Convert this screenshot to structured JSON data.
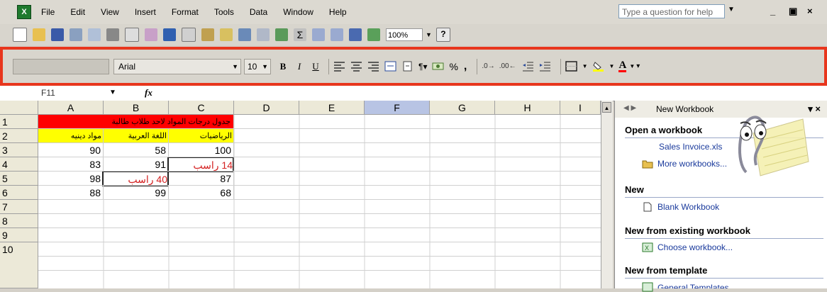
{
  "menu": [
    "File",
    "Edit",
    "View",
    "Insert",
    "Format",
    "Tools",
    "Data",
    "Window",
    "Help"
  ],
  "help_placeholder": "Type a question for help",
  "window_controls": [
    "_",
    "ȸ",
    "×"
  ],
  "standard_toolbar": {
    "zoom": "100%"
  },
  "formatting": {
    "font": "Arial",
    "size": "10",
    "bold": "B",
    "italic": "I",
    "underline": "U",
    "percent": "%",
    "comma": ","
  },
  "formula_bar": {
    "name_box": "F11",
    "fx": "fx"
  },
  "sheet": {
    "columns": [
      "A",
      "B",
      "C",
      "D",
      "E",
      "F",
      "G",
      "H",
      "I"
    ],
    "selected_column": "F",
    "rows": [
      "1",
      "2",
      "3",
      "4",
      "5",
      "6",
      "7",
      "8",
      "9",
      "10"
    ],
    "header_text": "جدول درجات المواد لاحد طلاب طالبة",
    "subjects": [
      "مواد دينيه",
      "اللغة العربية",
      "الرياضيات"
    ],
    "data": [
      [
        "90",
        "58",
        "100"
      ],
      [
        "83",
        "91",
        "14 راسب"
      ],
      [
        "98",
        "40 راسب",
        "87"
      ],
      [
        "88",
        "99",
        "68"
      ]
    ]
  },
  "task_pane": {
    "title": "New Workbook",
    "open_heading": "Open a workbook",
    "recent_file": "Sales Invoice.xls",
    "more": "More workbooks...",
    "new_heading": "New",
    "blank": "Blank Workbook",
    "existing_heading": "New from existing workbook",
    "choose": "Choose workbook...",
    "template_heading": "New from template",
    "general": "General Templates..."
  },
  "colors": {
    "highlight_frame": "#e8361d",
    "red_fill": "#ff0000",
    "yellow_fill": "#ffff00",
    "fail_text": "#d42020",
    "link": "#1a3a9c"
  }
}
